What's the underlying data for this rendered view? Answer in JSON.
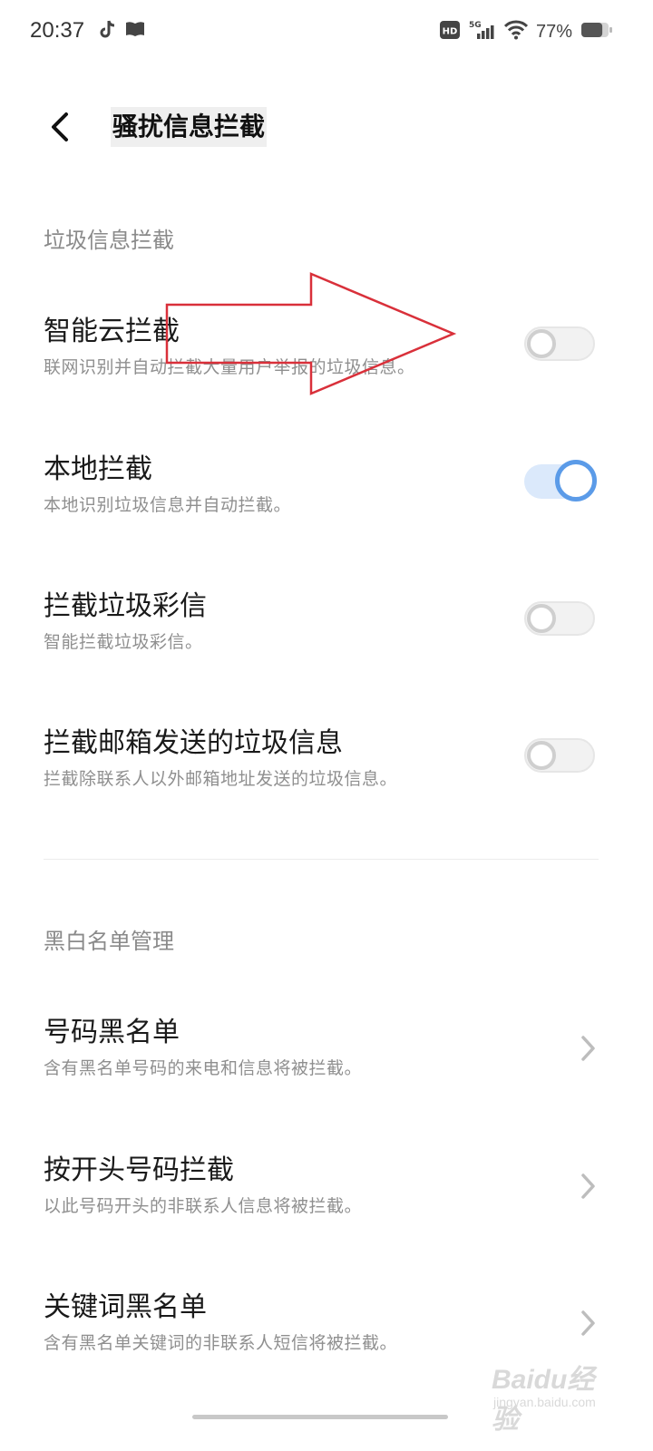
{
  "status_bar": {
    "time": "20:37",
    "left_icons": [
      "tiktok-icon",
      "book-icon"
    ],
    "right_icons": [
      "hd-icon",
      "signal-5g-icon",
      "wifi-icon",
      "battery-icon"
    ],
    "hd_label": "HD",
    "network_label": "5G",
    "battery_text": "77%",
    "battery_level": 0.77
  },
  "header": {
    "back_icon": "chevron-left-icon",
    "title": "骚扰信息拦截"
  },
  "sections": [
    {
      "title": "垃圾信息拦截",
      "items": [
        {
          "title": "智能云拦截",
          "desc": "联网识别并自动拦截大量用户举报的垃圾信息。",
          "control": "toggle",
          "enabled": false
        },
        {
          "title": "本地拦截",
          "desc": "本地识别垃圾信息并自动拦截。",
          "control": "toggle",
          "enabled": true
        },
        {
          "title": "拦截垃圾彩信",
          "desc": "智能拦截垃圾彩信。",
          "control": "toggle",
          "enabled": false
        },
        {
          "title": "拦截邮箱发送的垃圾信息",
          "desc": "拦截除联系人以外邮箱地址发送的垃圾信息。",
          "control": "toggle",
          "enabled": false
        }
      ]
    },
    {
      "title": "黑白名单管理",
      "items": [
        {
          "title": "号码黑名单",
          "desc": "含有黑名单号码的来电和信息将被拦截。",
          "control": "chevron"
        },
        {
          "title": "按开头号码拦截",
          "desc": "以此号码开头的非联系人信息将被拦截。",
          "control": "chevron"
        },
        {
          "title": "关键词黑名单",
          "desc": "含有黑名单关键词的非联系人短信将被拦截。",
          "control": "chevron"
        }
      ]
    }
  ],
  "colors": {
    "accent": "#5b9be8",
    "toggle_on_track": "#dbe9fb",
    "toggle_off_knob": "#cfcfcf",
    "annotation_arrow": "#d9303a"
  },
  "watermark": {
    "main": "Baidu经验",
    "sub": "jingyan.baidu.com"
  }
}
